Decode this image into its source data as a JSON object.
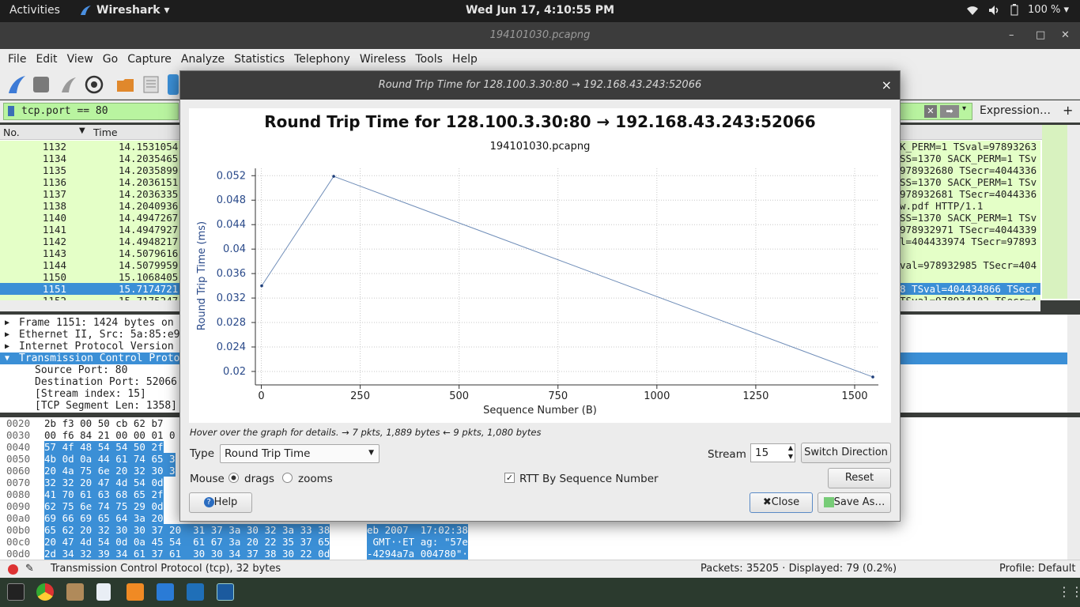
{
  "topbar": {
    "activities": "Activities",
    "app": "Wireshark ▾",
    "clock": "Wed Jun 17,  4:10:55 PM",
    "battery": "100 % ▾"
  },
  "window": {
    "title": "194101030.pcapng"
  },
  "menu": [
    "File",
    "Edit",
    "View",
    "Go",
    "Capture",
    "Analyze",
    "Statistics",
    "Telephony",
    "Wireless",
    "Tools",
    "Help"
  ],
  "filter": {
    "value": "tcp.port == 80",
    "expression": "Expression…",
    "plus": "+"
  },
  "packet_list": {
    "headers": {
      "no": "No.",
      "time": "Time"
    },
    "rows": [
      {
        "no": "1132",
        "time": "14.1531054",
        "info": "K_PERM=1 TSval=97893263"
      },
      {
        "no": "1134",
        "time": "14.2035465",
        "info": "SS=1370 SACK_PERM=1 TSv"
      },
      {
        "no": "1135",
        "time": "14.2035899",
        "info": "978932680 TSecr=4044336"
      },
      {
        "no": "1136",
        "time": "14.2036151",
        "info": "SS=1370 SACK_PERM=1 TSv"
      },
      {
        "no": "1137",
        "time": "14.2036335",
        "info": "978932681 TSecr=4044336"
      },
      {
        "no": "1138",
        "time": "14.2040936",
        "info": "w.pdf HTTP/1.1"
      },
      {
        "no": "1140",
        "time": "14.4947267",
        "info": "SS=1370 SACK_PERM=1 TSv"
      },
      {
        "no": "1141",
        "time": "14.4947927",
        "info": "978932971 TSecr=4044339"
      },
      {
        "no": "1142",
        "time": "14.4948217",
        "info": "l=404433974 TSecr=97893"
      },
      {
        "no": "1143",
        "time": "14.5079616",
        "info": ""
      },
      {
        "no": "1144",
        "time": "14.5079959",
        "info": "val=978932985 TSecr=404"
      },
      {
        "no": "1150",
        "time": "15.1068405",
        "info": ""
      },
      {
        "no": "1151",
        "time": "15.7174721",
        "info": "8 TSval=404434866 TSecr"
      },
      {
        "no": "1152",
        "time": "15.7175247",
        "info": "TSval=978934102 TSecr=4"
      }
    ]
  },
  "details": [
    {
      "text": "Frame 1151: 1424 bytes on",
      "arrow": "▶",
      "indent": 0
    },
    {
      "text": "Ethernet II, Src: 5a:85:e9",
      "arrow": "▶",
      "indent": 0
    },
    {
      "text": "Internet Protocol Version",
      "arrow": "▶",
      "indent": 0
    },
    {
      "text": "Transmission Control Proto",
      "arrow": "▼",
      "indent": 0
    },
    {
      "text": "Source Port: 80",
      "arrow": "",
      "indent": 1
    },
    {
      "text": "Destination Port: 52066",
      "arrow": "",
      "indent": 1
    },
    {
      "text": "[Stream index: 15]",
      "arrow": "",
      "indent": 1
    },
    {
      "text": "[TCP Segment Len: 1358]",
      "arrow": "",
      "indent": 1
    }
  ],
  "bytes": [
    {
      "off": "0020",
      "hex": "2b f3 00 50 cb 62 b7",
      "ascii": ""
    },
    {
      "off": "0030",
      "hex": "00 f6 84 21 00 00 01 0",
      "ascii": ""
    },
    {
      "off": "0040",
      "hex": "57 4f 48 54 54 50 2f",
      "ascii": ""
    },
    {
      "off": "0050",
      "hex": "4b 0d 0a 44 61 74 65 3",
      "ascii": ""
    },
    {
      "off": "0060",
      "hex": "20 4a 75 6e 20 32 30 3",
      "ascii": ""
    },
    {
      "off": "0070",
      "hex": "32 32 20 47 4d 54 0d",
      "ascii": ""
    },
    {
      "off": "0080",
      "hex": "41 70 61 63 68 65 2f",
      "ascii": ""
    },
    {
      "off": "0090",
      "hex": "62 75 6e 74 75 29 0d",
      "ascii": ""
    },
    {
      "off": "00a0",
      "hex": "69 66 69 65 64 3a 20",
      "ascii": ""
    },
    {
      "off": "00b0",
      "hex": "65 62 20 32 30 30 37 20  31 37 3a 30 32 3a 33 38",
      "ascii": "eb 2007  17:02:38"
    },
    {
      "off": "00c0",
      "hex": "20 47 4d 54 0d 0a 45 54  61 67 3a 20 22 35 37 65",
      "ascii": " GMT··ET ag: \"57e"
    },
    {
      "off": "00d0",
      "hex": "2d 34 32 39 34 61 37 61  30 30 34 37 38 30 22 0d",
      "ascii": "-4294a7a 004780\"·"
    }
  ],
  "status": {
    "left": "Transmission Control Protocol (tcp), 32 bytes",
    "packets": "Packets: 35205 · Displayed: 79 (0.2%)",
    "profile": "Profile: Default"
  },
  "dialog": {
    "title": "Round Trip Time for 128.100.3.30:80 → 192.168.43.243:52066",
    "close_x": "×",
    "hover": "Hover over the graph for details. → 7 pkts, 1,889 bytes ← 9 pkts, 1,080 bytes",
    "type_label": "Type",
    "type_value": "Round Trip Time",
    "stream_label": "Stream",
    "stream_value": "15",
    "switch": "Switch Direction",
    "mouse_label": "Mouse",
    "drags": "drags",
    "zooms": "zooms",
    "rtt_seq": "RTT By Sequence Number",
    "reset": "Reset",
    "help": "Help",
    "close": "Close",
    "save": "Save As…"
  },
  "chart_data": {
    "type": "line",
    "title": "Round Trip Time for 128.100.3.30:80 → 192.168.43.243:52066",
    "subtitle": "194101030.pcapng",
    "xlabel": "Sequence Number (B)",
    "ylabel": "Round Trip Time (ms)",
    "x": [
      1,
      183,
      1546
    ],
    "y": [
      0.034,
      0.0519,
      0.0191
    ],
    "xlim": [
      -15,
      1560
    ],
    "ylim": [
      0.0178,
      0.0532
    ],
    "xticks": [
      0,
      250,
      500,
      750,
      1000,
      1250,
      1500
    ],
    "yticks": [
      "0.02",
      "0.024",
      "0.028",
      "0.032",
      "0.036",
      "0.04",
      "0.044",
      "0.048",
      "0.052"
    ],
    "grid": true,
    "line_color": "#6f8db8"
  }
}
